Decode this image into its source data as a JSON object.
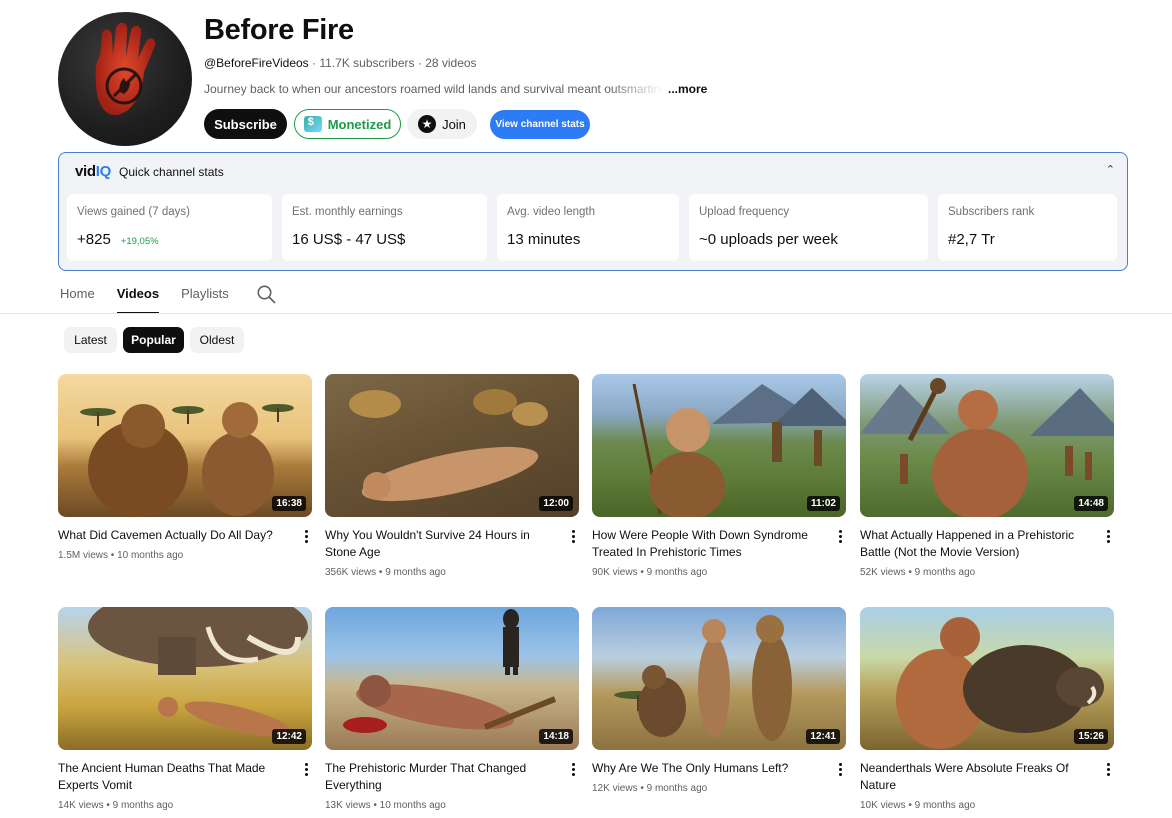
{
  "channel": {
    "name": "Before Fire",
    "handle": "@BeforeFireVideos",
    "subscribers": "11.7K subscribers",
    "videos_count": "28 videos",
    "separator": " · ",
    "description": "Journey back to when our ancestors roamed wild lands and survival meant outsmarting",
    "more_label": "...more"
  },
  "actions": {
    "subscribe": "Subscribe",
    "monetized": "Monetized",
    "join": "Join",
    "view_stats": "View channel stats"
  },
  "vidiq": {
    "logo_left": "vid",
    "logo_right": "IQ",
    "title": "Quick channel stats",
    "collapse_icon": "chevron-up-icon",
    "stats": [
      {
        "label": "Views gained (7 days)",
        "value": "+825",
        "delta": "+19,05%"
      },
      {
        "label": "Est. monthly earnings",
        "value": "16 US$ - 47 US$"
      },
      {
        "label": "Avg. video length",
        "value": "13 minutes"
      },
      {
        "label": "Upload frequency",
        "value": "~0 uploads per week"
      },
      {
        "label": "Subscribers rank",
        "value": "#2,7 Tr"
      }
    ]
  },
  "tabs": [
    "Home",
    "Videos",
    "Playlists"
  ],
  "active_tab": "Videos",
  "chips": [
    "Latest",
    "Popular",
    "Oldest"
  ],
  "active_chip": "Popular",
  "videos": [
    {
      "title": "What Did Cavemen Actually Do All Day?",
      "views": "1.5M views",
      "age": "10 months ago",
      "duration": "16:38"
    },
    {
      "title": "Why You Wouldn't Survive 24 Hours in Stone Age",
      "views": "356K views",
      "age": "9 months ago",
      "duration": "12:00"
    },
    {
      "title": "How Were People With Down Syndrome Treated In Prehistoric Times",
      "views": "90K views",
      "age": "9 months ago",
      "duration": "11:02"
    },
    {
      "title": "What Actually Happened in a Prehistoric Battle (Not the Movie Version)",
      "views": "52K views",
      "age": "9 months ago",
      "duration": "14:48"
    },
    {
      "title": "The Ancient Human Deaths That Made Experts Vomit",
      "views": "14K views",
      "age": "9 months ago",
      "duration": "12:42"
    },
    {
      "title": "The Prehistoric Murder That Changed Everything",
      "views": "13K views",
      "age": "10 months ago",
      "duration": "14:18"
    },
    {
      "title": "Why Are We The Only Humans Left?",
      "views": "12K views",
      "age": "9 months ago",
      "duration": "12:41"
    },
    {
      "title": "Neanderthals Were Absolute Freaks Of Nature",
      "views": "10K views",
      "age": "9 months ago",
      "duration": "15:26"
    }
  ],
  "meta_separator": " • ",
  "colors": {
    "subscribe_bg": "#0f0f0f",
    "monetized": "#1d9c45",
    "stats_button": "#2d7cf6",
    "vidiq_border": "#4a7fd0",
    "delta_green": "#1d9c45"
  }
}
